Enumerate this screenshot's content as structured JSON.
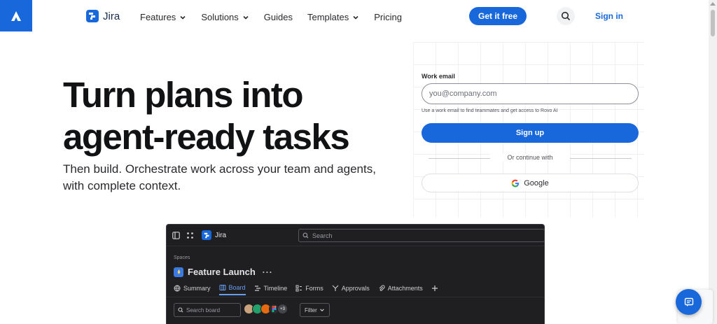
{
  "header": {
    "product_name": "Jira",
    "nav": [
      {
        "label": "Features",
        "has_dropdown": true
      },
      {
        "label": "Solutions",
        "has_dropdown": true
      },
      {
        "label": "Guides",
        "has_dropdown": false
      },
      {
        "label": "Templates",
        "has_dropdown": true
      },
      {
        "label": "Pricing",
        "has_dropdown": false
      }
    ],
    "cta_label": "Get it free",
    "signin_label": "Sign in"
  },
  "hero": {
    "headline_line1": "Turn plans into",
    "headline_line2": "agent-ready tasks",
    "subhead": "Then build. Orchestrate work across your team and agents, with complete context."
  },
  "signup_form": {
    "email_label": "Work email",
    "email_placeholder": "you@company.com",
    "email_value": "",
    "helper_text": "Use a work email to find teammates and get access to Rovo AI",
    "signup_label": "Sign up",
    "divider_text": "Or continue with",
    "google_label": "Google"
  },
  "preview": {
    "product_name": "Jira",
    "search_placeholder": "Search",
    "breadcrumb": "Spaces",
    "space_name": "Feature Launch",
    "tabs": [
      {
        "label": "Summary",
        "icon": "globe-icon",
        "active": false
      },
      {
        "label": "Board",
        "icon": "board-icon",
        "active": true
      },
      {
        "label": "Timeline",
        "icon": "timeline-icon",
        "active": false
      },
      {
        "label": "Forms",
        "icon": "forms-icon",
        "active": false
      },
      {
        "label": "Approvals",
        "icon": "approvals-icon",
        "active": false
      },
      {
        "label": "Attachments",
        "icon": "paperclip-icon",
        "active": false
      }
    ],
    "board_search_placeholder": "Search board",
    "extra_avatars": "+3",
    "filter_label": "Filter"
  },
  "colors": {
    "brand_blue": "#1868db",
    "preview_bg": "#1f1f21",
    "active_tab": "#669df1"
  }
}
